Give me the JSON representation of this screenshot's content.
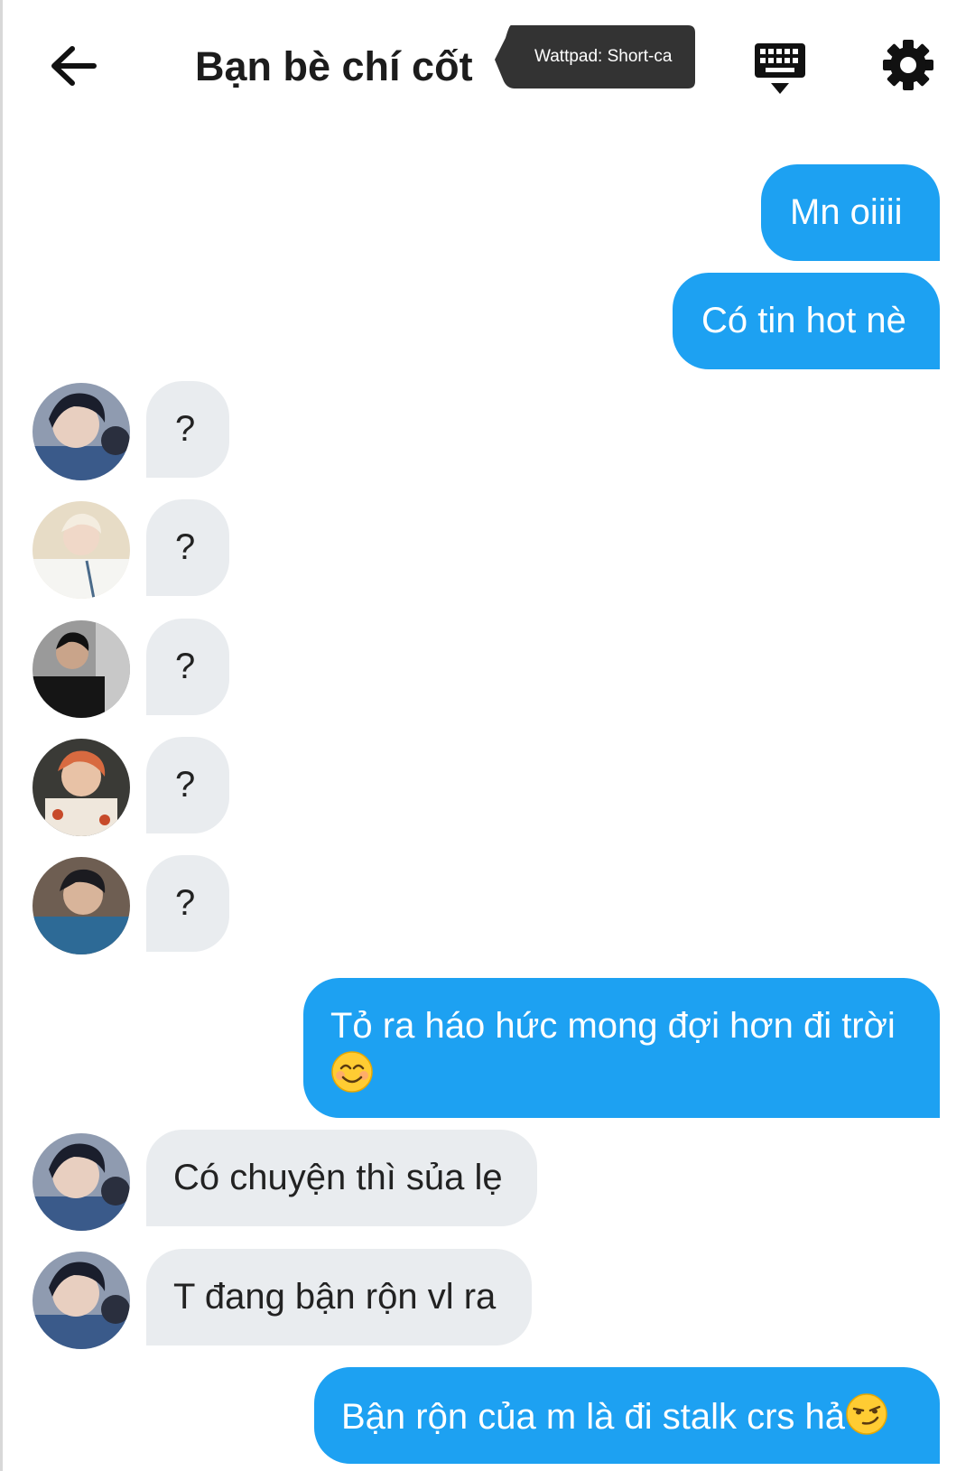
{
  "header": {
    "title": "Bạn bè chí cốt",
    "tooltip": "Wattpad: Short-ca"
  },
  "icons": {
    "back": "arrow-left-icon",
    "keyboard": "keyboard-icon",
    "settings": "gear-icon"
  },
  "colors": {
    "sent_bubble": "#1da1f2",
    "received_bubble": "#e9ecef",
    "tooltip_bg": "#333333"
  },
  "messages": [
    {
      "from": "me",
      "text": "Mn oiiii"
    },
    {
      "from": "me",
      "text": "Có tin hot nè"
    },
    {
      "from": "friend-1",
      "text": "?"
    },
    {
      "from": "friend-2",
      "text": "?"
    },
    {
      "from": "friend-3",
      "text": "?"
    },
    {
      "from": "friend-4",
      "text": "?"
    },
    {
      "from": "friend-5",
      "text": "?"
    },
    {
      "from": "me",
      "text": "Tỏ ra háo hức mong đợi hơn đi trời",
      "emoji": "smiling-face-emoji"
    },
    {
      "from": "friend-1",
      "text": "Có chuyện thì sủa lẹ"
    },
    {
      "from": "friend-1",
      "text": "T đang bận rộn vl ra"
    },
    {
      "from": "me",
      "text": "Bận rộn của m là đi stalk crs hả",
      "emoji": "smirking-face-emoji"
    }
  ]
}
